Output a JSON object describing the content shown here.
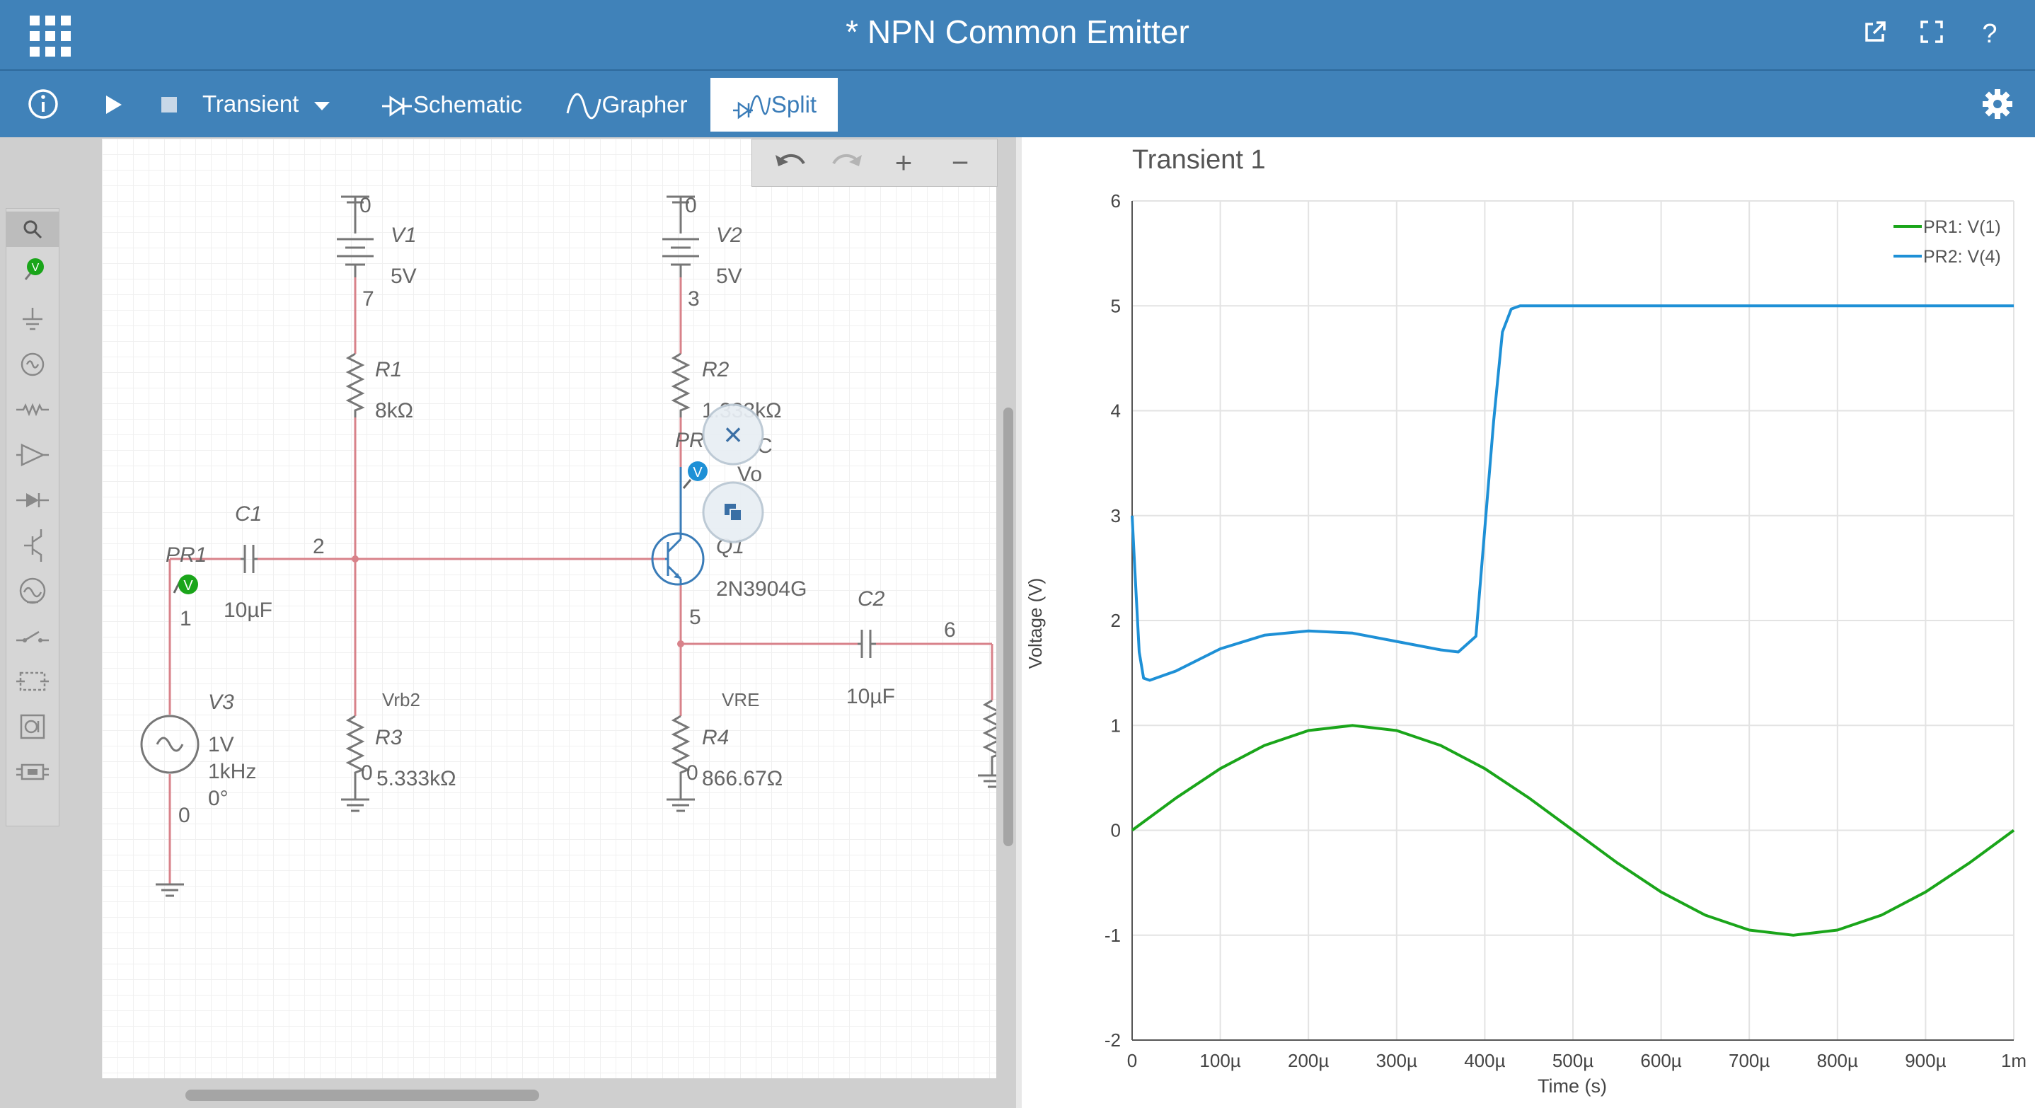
{
  "window": {
    "title": "* NPN Common Emitter"
  },
  "titlebar": {
    "icons": [
      "app-grid-icon",
      "popout-icon",
      "fullscreen-icon",
      "help-icon"
    ],
    "help_label": "?"
  },
  "toolbar": {
    "info_icon": "info-icon",
    "run_icon": "play-icon",
    "stop_icon": "stop-icon",
    "analysis": "Transient",
    "tabs": [
      {
        "label": "Schematic",
        "icon": "schematic-icon",
        "active": false
      },
      {
        "label": "Grapher",
        "icon": "grapher-icon",
        "active": false
      },
      {
        "label": "Split",
        "icon": "split-icon",
        "active": true
      }
    ],
    "settings_icon": "gear-icon"
  },
  "palette": {
    "items": [
      "search-icon",
      "voltage-probe-icon",
      "ground-icon",
      "source-icon",
      "resistor-icon",
      "opamp-icon",
      "diode-icon",
      "transistor-icon",
      "meter-icon",
      "switch-icon",
      "module-icon",
      "instrument-icon",
      "connector-icon"
    ]
  },
  "schematic_tools": {
    "icons": [
      "undo-icon",
      "redo-icon",
      "zoom-in-icon",
      "zoom-out-icon"
    ],
    "zoom_in": "+",
    "zoom_out": "−"
  },
  "schematic": {
    "V1": {
      "name": "V1",
      "value": "5V",
      "node_top": "0",
      "node_bottom": "7"
    },
    "V2": {
      "name": "V2",
      "value": "5V",
      "node_top": "0",
      "node_bottom": "3"
    },
    "R1": {
      "name": "R1",
      "value": "8kΩ"
    },
    "R2": {
      "name": "R2",
      "value": "1.333kΩ"
    },
    "R3": {
      "name": "R3",
      "value": "5.333kΩ",
      "node": "0",
      "label": "Vrb2"
    },
    "R4": {
      "name": "R4",
      "value": "866.67Ω",
      "node": "0",
      "label": "VRE"
    },
    "C1": {
      "name": "C1",
      "value": "10µF"
    },
    "C2": {
      "name": "C2",
      "value": "10µF"
    },
    "Q1": {
      "name": "Q1",
      "model": "2N3904G"
    },
    "V3": {
      "name": "V3",
      "amp": "1V",
      "freq": "1kHz",
      "phase": "0°",
      "node": "0"
    },
    "nodes": {
      "n2": "2",
      "n1": "1",
      "n5": "5",
      "n6": "6"
    },
    "PR1": {
      "name": "PR1",
      "badge": "V"
    },
    "PR2": {
      "name": "PR",
      "badge": "V",
      "label": "Vo",
      "extra": "C"
    },
    "popup": {
      "close": "×",
      "close_icon": "close-icon",
      "copy_icon": "copy-icon"
    }
  },
  "chart_data": {
    "type": "line",
    "title": "Transient 1",
    "xlabel": "Time (s)",
    "ylabel": "Voltage (V)",
    "xlim": [
      0,
      0.001
    ],
    "ylim": [
      -2,
      6
    ],
    "x_ticks": [
      "0",
      "100µ",
      "200µ",
      "300µ",
      "400µ",
      "500µ",
      "600µ",
      "700µ",
      "800µ",
      "900µ",
      "1m"
    ],
    "y_ticks": [
      "-2",
      "-1",
      "0",
      "1",
      "2",
      "3",
      "4",
      "5",
      "6"
    ],
    "grid": true,
    "legend_position": "top-right",
    "series": [
      {
        "name": "PR1: V(1)",
        "color": "#1aa51a",
        "x": [
          0,
          5e-05,
          0.0001,
          0.00015,
          0.0002,
          0.00025,
          0.0003,
          0.00035,
          0.0004,
          0.00045,
          0.0005,
          0.00055,
          0.0006,
          0.00065,
          0.0007,
          0.00075,
          0.0008,
          0.00085,
          0.0009,
          0.00095,
          0.001
        ],
        "y": [
          0,
          0.309,
          0.588,
          0.809,
          0.951,
          1.0,
          0.951,
          0.809,
          0.588,
          0.309,
          0,
          -0.309,
          -0.588,
          -0.809,
          -0.951,
          -1.0,
          -0.951,
          -0.809,
          -0.588,
          -0.309,
          0
        ]
      },
      {
        "name": "PR2: V(4)",
        "color": "#1e90d6",
        "x": [
          0,
          3e-06,
          8e-06,
          1.3e-05,
          2e-05,
          5e-05,
          0.0001,
          0.00015,
          0.0002,
          0.00025,
          0.0003,
          0.00035,
          0.00037,
          0.00039,
          0.00041,
          0.00042,
          0.00043,
          0.00044,
          0.00046,
          0.0005,
          0.0006,
          0.0007,
          0.0008,
          0.0009,
          0.001
        ],
        "y": [
          3.0,
          2.5,
          1.7,
          1.45,
          1.43,
          1.52,
          1.73,
          1.86,
          1.9,
          1.88,
          1.8,
          1.72,
          1.7,
          1.85,
          3.9,
          4.75,
          4.97,
          5.0,
          5.0,
          5.0,
          5.0,
          5.0,
          5.0,
          5.0,
          5.0
        ]
      }
    ]
  }
}
